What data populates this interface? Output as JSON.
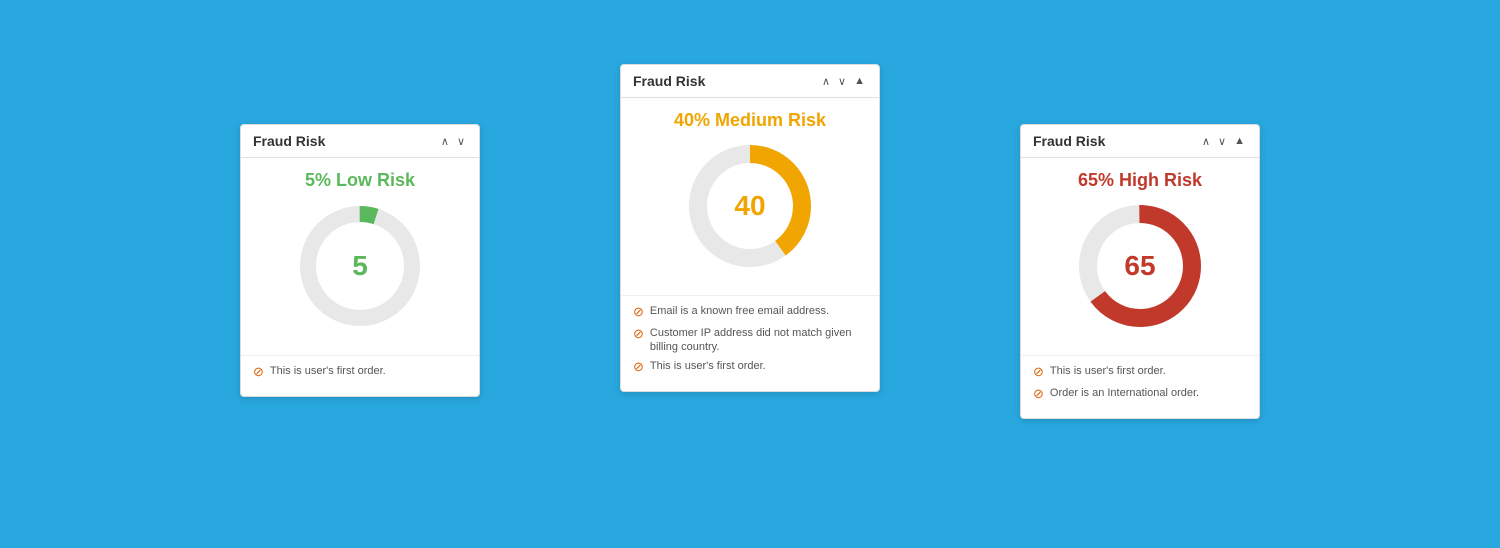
{
  "cards": {
    "left": {
      "title": "Fraud Risk",
      "controls": [
        "∧",
        "∨"
      ],
      "risk_label": "5% Low Risk",
      "risk_class": "low",
      "value": "5",
      "value_class": "low",
      "percent": 5,
      "color": "#5cb85c",
      "warnings": [
        {
          "text": "This is user's first order."
        }
      ]
    },
    "center": {
      "title": "Fraud Risk",
      "controls": [
        "∧",
        "∨",
        "▲"
      ],
      "risk_label": "40% Medium Risk",
      "risk_class": "medium",
      "value": "40",
      "value_class": "medium",
      "percent": 40,
      "color": "#f0a500",
      "warnings": [
        {
          "text": "Email is a known free email address."
        },
        {
          "text": "Customer IP address did not match given billing country."
        },
        {
          "text": "This is user's first order."
        }
      ]
    },
    "right": {
      "title": "Fraud Risk",
      "controls": [
        "∧",
        "∨",
        "▲"
      ],
      "risk_label": "65% High Risk",
      "risk_class": "high",
      "value": "65",
      "value_class": "high",
      "percent": 65,
      "color": "#c0392b",
      "warnings": [
        {
          "text": "This is user's first order."
        },
        {
          "text": "Order is an International order."
        }
      ]
    }
  }
}
